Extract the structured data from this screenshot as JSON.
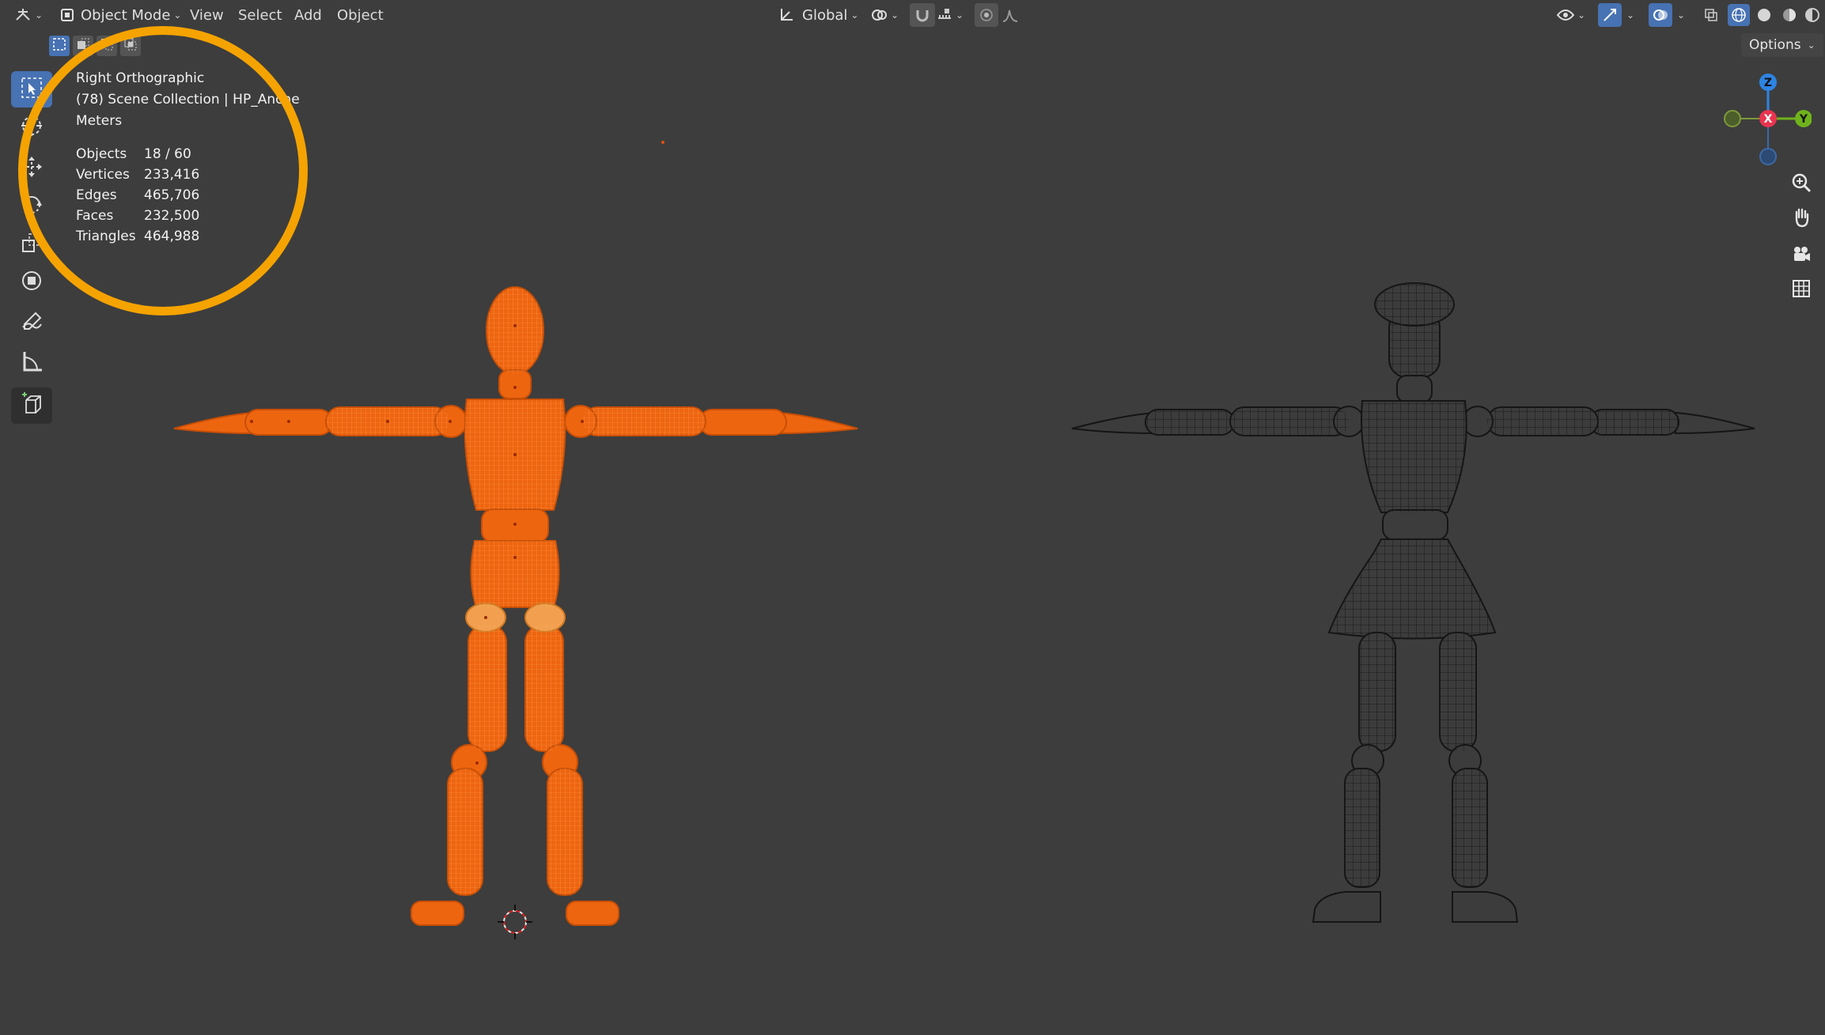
{
  "header": {
    "mode_label": "Object Mode",
    "menus": [
      "View",
      "Select",
      "Add",
      "Object"
    ],
    "orientation_label": "Global"
  },
  "viewport": {
    "view_name": "Right Orthographic",
    "collection_line": "(78) Scene Collection | HP_Anche",
    "units": "Meters",
    "stats": [
      {
        "label": "Objects",
        "value": "18 / 60"
      },
      {
        "label": "Vertices",
        "value": "233,416"
      },
      {
        "label": "Edges",
        "value": "465,706"
      },
      {
        "label": "Faces",
        "value": "232,500"
      },
      {
        "label": "Triangles",
        "value": "464,988"
      }
    ],
    "options_label": "Options"
  },
  "gizmo": {
    "x_label": "X",
    "y_label": "Y",
    "z_label": "Z"
  },
  "colors": {
    "viewport_bg": "#3d3d3d",
    "selected_object": "#f06a10",
    "active_tool": "#4772b3",
    "annotation_circle": "#f5a300",
    "axis_x": "#e8344f",
    "axis_y": "#6fb31c",
    "axis_z": "#2e84e3"
  },
  "icons": {
    "select_box": "select-box-icon",
    "cursor": "cursor-icon",
    "move": "move-icon",
    "rotate": "rotate-icon",
    "scale": "scale-icon",
    "transform": "transform-icon",
    "annotate": "annotate-icon",
    "measure": "measure-icon",
    "add_cube": "add-cube-icon",
    "zoom": "zoom-icon",
    "pan": "hand-icon",
    "camera": "camera-icon",
    "grid": "grid-icon"
  }
}
